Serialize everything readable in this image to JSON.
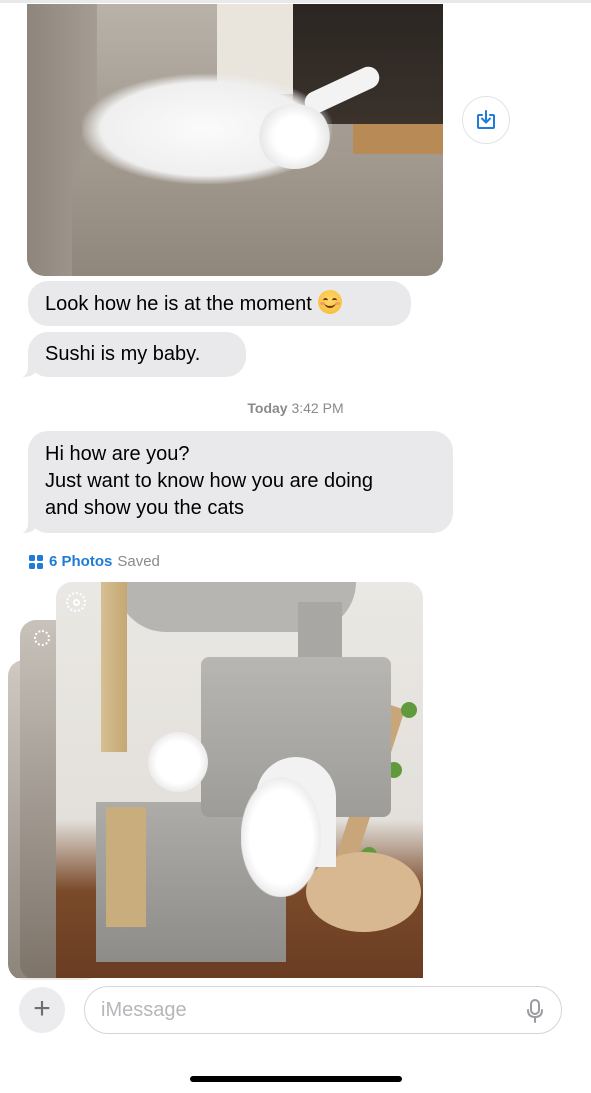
{
  "conversation": {
    "first_photo": {
      "description_icon": "save-photo-icon"
    },
    "messages": [
      {
        "text": "Look how he is at the moment",
        "emoji": "smiling-face-icon"
      },
      {
        "text": "Sushi is my baby."
      }
    ],
    "timestamp": {
      "day": "Today",
      "time": "3:42 PM"
    },
    "second_message": {
      "lines": [
        "Hi how are you?",
        "Just want to know how you are doing",
        "and show you the cats"
      ]
    },
    "photos_saved": {
      "count_label": "6 Photos",
      "status": "Saved"
    }
  },
  "composer": {
    "plus_label": "+",
    "placeholder": "iMessage"
  },
  "colors": {
    "accent": "#1f7ad8",
    "bubble_gray": "#e9e9eb",
    "timestamp_gray": "#8a8a8e"
  }
}
